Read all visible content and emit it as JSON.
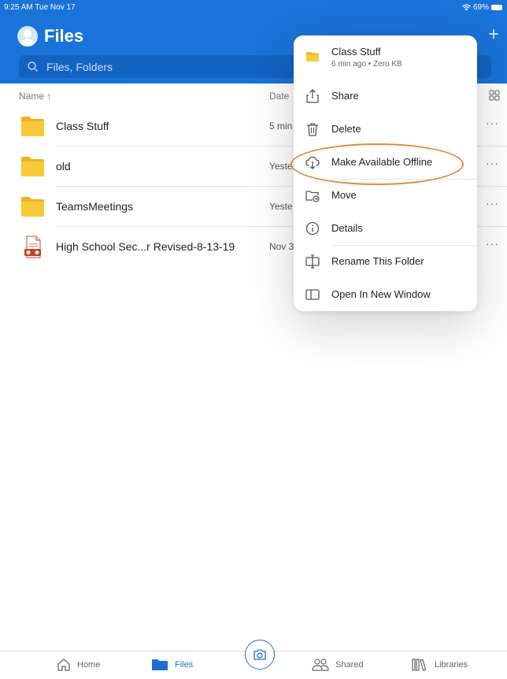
{
  "status_bar": {
    "time": "9:25 AM  Tue Nov 17",
    "battery": "69%"
  },
  "header": {
    "title": "Files",
    "add_icon": "plus-icon"
  },
  "search": {
    "placeholder": "Files, Folders"
  },
  "columns": {
    "name": "Name ↑",
    "date": "Date"
  },
  "files": [
    {
      "name": "Class Stuff",
      "date": "5 min",
      "type": "folder"
    },
    {
      "name": "old",
      "date": "Yeste",
      "type": "folder"
    },
    {
      "name": "TeamsMeetings",
      "date": "Yeste",
      "type": "folder"
    },
    {
      "name": "High School Sec...r Revised-8-13-19",
      "date": "Nov 3",
      "type": "presentation"
    }
  ],
  "menu": {
    "title": "Class Stuff",
    "subtitle": "6 min ago • Zero KB",
    "items": [
      {
        "label": "Share",
        "icon": "share-icon"
      },
      {
        "label": "Delete",
        "icon": "trash-icon"
      },
      {
        "label": "Make Available Offline",
        "icon": "cloud-download-icon"
      },
      {
        "label": "Move",
        "icon": "move-folder-icon"
      },
      {
        "label": "Details",
        "icon": "info-icon"
      },
      {
        "label": "Rename This Folder",
        "icon": "rename-icon"
      },
      {
        "label": "Open In New Window",
        "icon": "window-icon"
      }
    ]
  },
  "tabs": [
    {
      "label": "Home",
      "icon": "home-icon",
      "active": false
    },
    {
      "label": "Files",
      "icon": "folder-icon",
      "active": true
    },
    {
      "label": "Shared",
      "icon": "people-icon",
      "active": false
    },
    {
      "label": "Libraries",
      "icon": "library-icon",
      "active": false
    }
  ],
  "colors": {
    "header_bg": "#1a73d8",
    "accent": "#1f6fd1",
    "folder": "#f6c02c",
    "highlight_ring": "#e38a3d"
  }
}
